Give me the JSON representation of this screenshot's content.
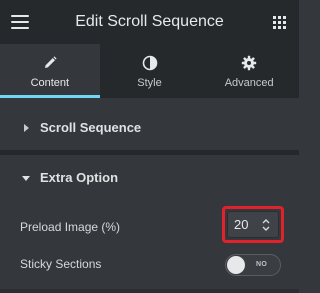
{
  "header": {
    "title": "Edit Scroll Sequence"
  },
  "tabs": [
    {
      "label": "Content",
      "icon": "pencil-icon",
      "active": true
    },
    {
      "label": "Style",
      "icon": "contrast-icon",
      "active": false
    },
    {
      "label": "Advanced",
      "icon": "gear-icon",
      "active": false
    }
  ],
  "sections": [
    {
      "title": "Scroll Sequence",
      "expanded": false
    },
    {
      "title": "Extra Option",
      "expanded": true
    }
  ],
  "controls": {
    "preload": {
      "label": "Preload Image (%)",
      "value": "20"
    },
    "sticky": {
      "label": "Sticky Sections",
      "toggle_text": "NO",
      "on": false
    }
  },
  "colors": {
    "accent": "#71d7f7",
    "highlight": "#e0232b",
    "panel": "#34383c",
    "header": "#26292c"
  }
}
